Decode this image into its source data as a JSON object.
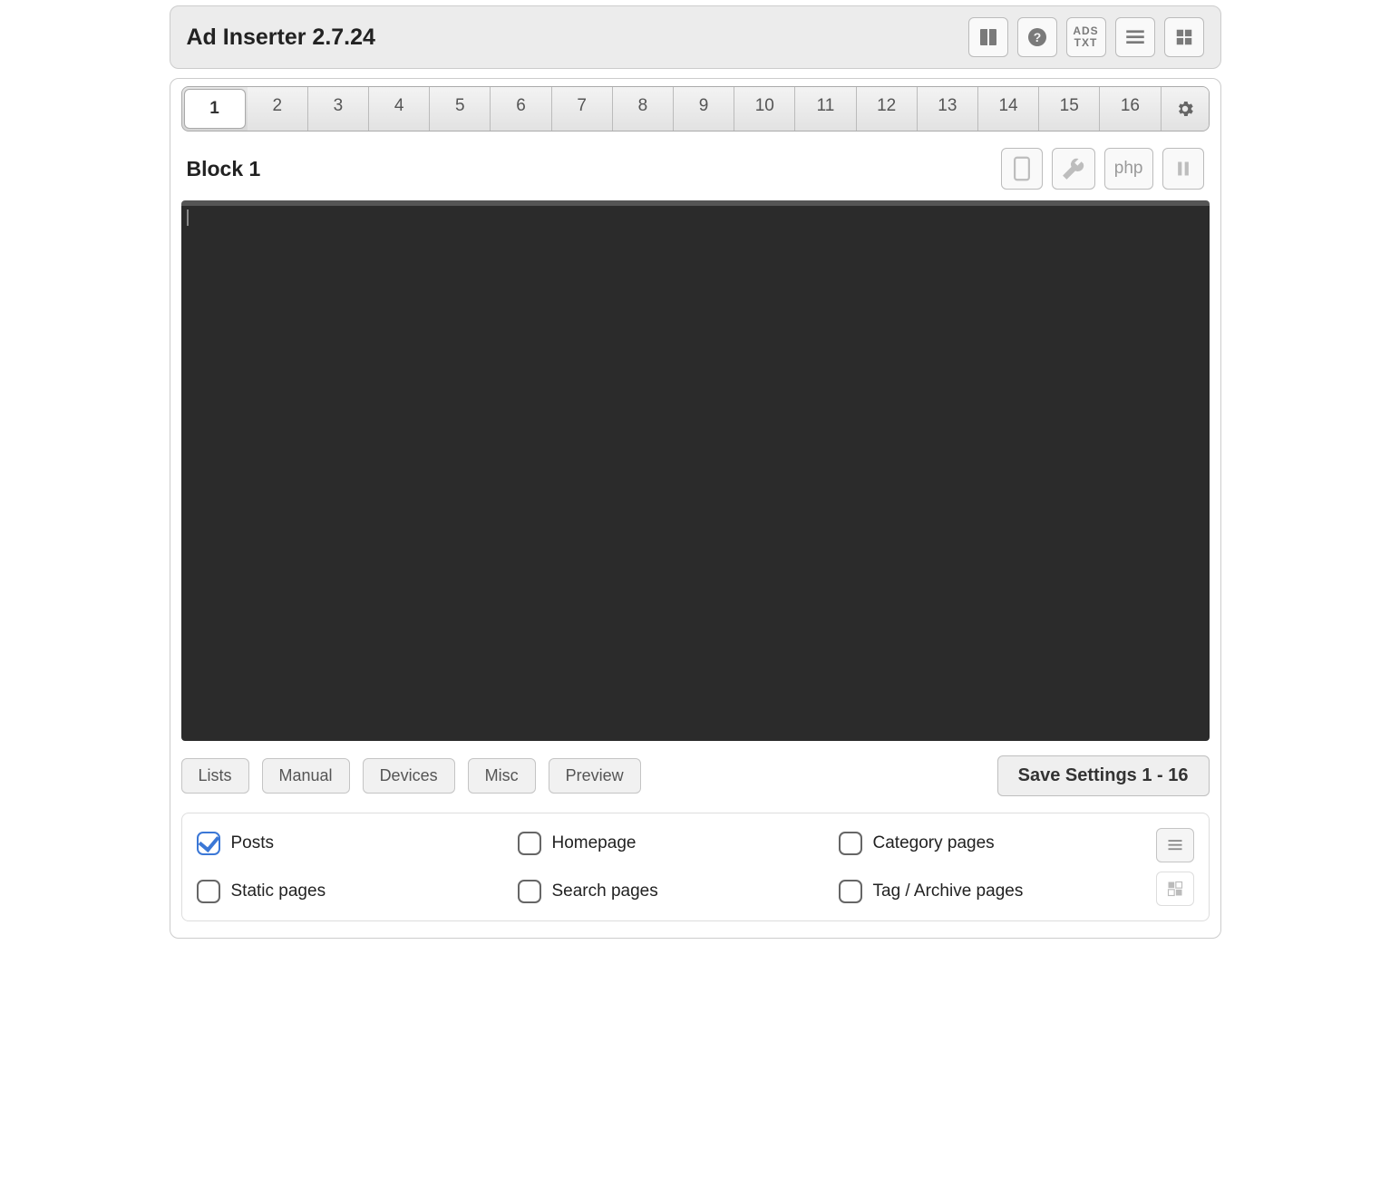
{
  "header": {
    "title": "Ad Inserter 2.7.24",
    "icons": {
      "docs": "docs-icon",
      "help": "help-icon",
      "ads_txt": "ADS\nTXT",
      "list": "list-icon",
      "blocks": "blocks-icon"
    }
  },
  "tabs": {
    "items": [
      "1",
      "2",
      "3",
      "4",
      "5",
      "6",
      "7",
      "8",
      "9",
      "10",
      "11",
      "12",
      "13",
      "14",
      "15",
      "16"
    ],
    "active_index": 0
  },
  "block": {
    "title": "Block 1",
    "tools": {
      "php_label": "php"
    }
  },
  "editor": {
    "content": ""
  },
  "buttons": {
    "lists": "Lists",
    "manual": "Manual",
    "devices": "Devices",
    "misc": "Misc",
    "preview": "Preview",
    "save": "Save Settings 1 - 16"
  },
  "checks": {
    "posts": {
      "label": "Posts",
      "checked": true
    },
    "static": {
      "label": "Static pages",
      "checked": false
    },
    "homepage": {
      "label": "Homepage",
      "checked": false
    },
    "search": {
      "label": "Search pages",
      "checked": false
    },
    "category": {
      "label": "Category pages",
      "checked": false
    },
    "tag": {
      "label": "Tag / Archive pages",
      "checked": false
    }
  }
}
